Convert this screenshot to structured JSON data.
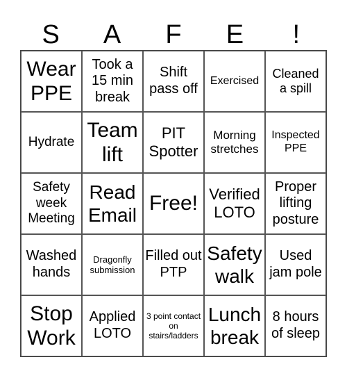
{
  "header": [
    "S",
    "A",
    "F",
    "E",
    "!"
  ],
  "cells": [
    "Wear PPE",
    "Took a 15 min break",
    "Shift pass off",
    "Exercised",
    "Cleaned a spill",
    "Hydrate",
    "Team lift",
    "PIT Spotter",
    "Morning stretches",
    "Inspected PPE",
    "Safety week Meeting",
    "Read Email",
    "Free!",
    "Verified LOTO",
    "Proper lifting posture",
    "Washed hands",
    "Dragonfly submission",
    "Filled out PTP",
    "Safety walk",
    "Used jam pole",
    "Stop Work",
    "Applied LOTO",
    "3 point contact on stairs/ladders",
    "Lunch break",
    "8 hours of sleep"
  ]
}
